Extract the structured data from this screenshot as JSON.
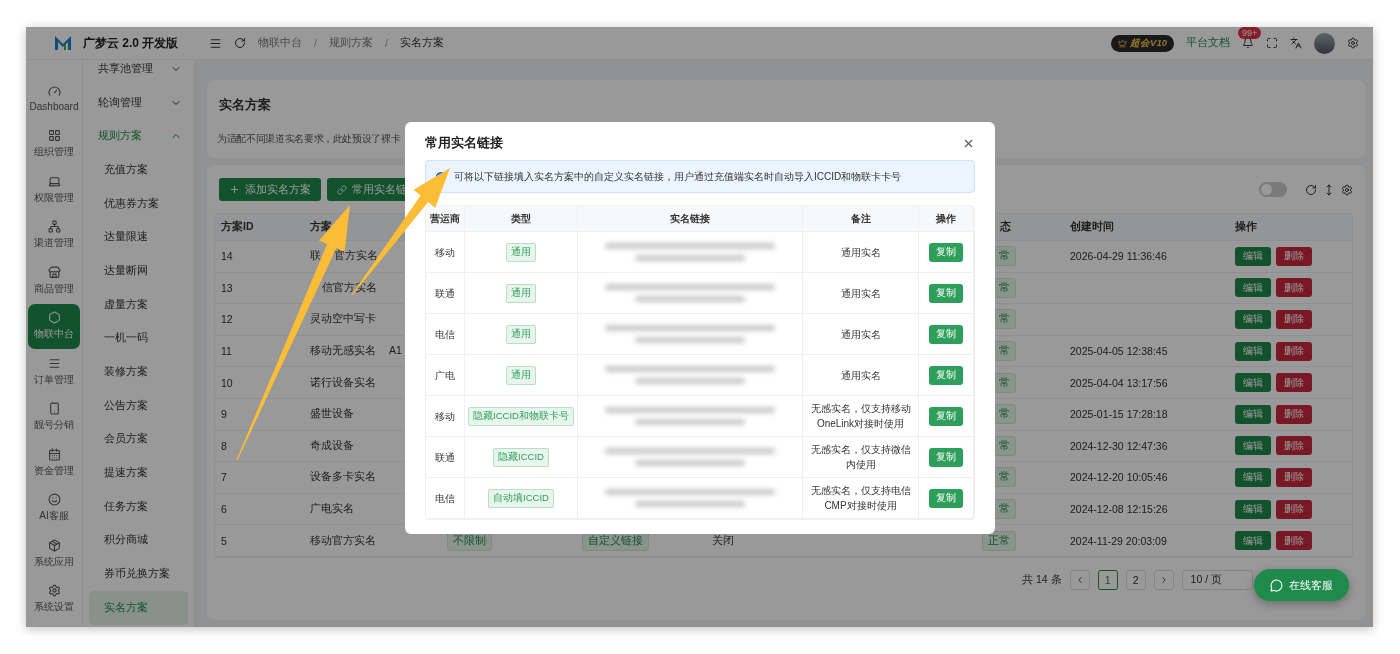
{
  "app": {
    "title": "广梦云 2.0 开发版"
  },
  "rail": [
    {
      "label": "Dashboard",
      "selected": false
    },
    {
      "label": "组织管理",
      "selected": false
    },
    {
      "label": "权限管理",
      "selected": false
    },
    {
      "label": "渠道管理",
      "selected": false
    },
    {
      "label": "商品管理",
      "selected": false
    },
    {
      "label": "物联中台",
      "selected": true
    },
    {
      "label": "订单管理",
      "selected": false
    },
    {
      "label": "靓号分销",
      "selected": false
    },
    {
      "label": "资金管理",
      "selected": false
    },
    {
      "label": "AI客服",
      "selected": false
    },
    {
      "label": "系统应用",
      "selected": false
    },
    {
      "label": "系统设置",
      "selected": false
    }
  ],
  "submenu": [
    {
      "label": "共享池管理",
      "expanded": false
    },
    {
      "label": "轮询管理",
      "expanded": false
    },
    {
      "label": "规则方案",
      "expanded": true,
      "children": [
        {
          "label": "充值方案",
          "selected": false
        },
        {
          "label": "优惠券方案",
          "selected": false
        },
        {
          "label": "达量限速",
          "selected": false
        },
        {
          "label": "达量断网",
          "selected": false
        },
        {
          "label": "虚量方案",
          "selected": false
        },
        {
          "label": "一机一码",
          "selected": false
        },
        {
          "label": "装修方案",
          "selected": false
        },
        {
          "label": "公告方案",
          "selected": false
        },
        {
          "label": "会员方案",
          "selected": false
        },
        {
          "label": "提速方案",
          "selected": false
        },
        {
          "label": "任务方案",
          "selected": false
        },
        {
          "label": "积分商城",
          "selected": false
        },
        {
          "label": "券币兑换方案",
          "selected": false
        },
        {
          "label": "实名方案",
          "selected": true
        }
      ]
    }
  ],
  "header": {
    "breadcrumb": [
      "物联中台",
      "规则方案",
      "实名方案"
    ],
    "separator": "/",
    "vip_badge": "超会V10",
    "docs_link": "平台文档",
    "notification_count": "99+"
  },
  "page": {
    "title": "实名方案",
    "description": "为适配不同渠道实名要求，此处预设了裸卡"
  },
  "toolbar": {
    "buttons": [
      "添加实名方案",
      "常用实名链"
    ],
    "toggle_on": false
  },
  "table": {
    "columns": {
      "id": "方案ID",
      "name": "方案",
      "status": "态",
      "created": "创建时间",
      "actions": "操作"
    },
    "rows": [
      {
        "id": "14",
        "name": "联 官方实名",
        "status": "常",
        "created": "2026-04-29 11:36:46",
        "actions": [
          "编辑",
          "删除"
        ]
      },
      {
        "id": "13",
        "name": "信官方实名",
        "name_offset": true,
        "status": "常",
        "actions": [
          "编辑",
          "删除"
        ]
      },
      {
        "id": "12",
        "name": "灵动空中写卡",
        "status": "常",
        "actions": [
          "编辑",
          "删除"
        ]
      },
      {
        "id": "11",
        "name": "移动无感实名 A1",
        "status": "常",
        "created": "2025-04-05 12:38:45",
        "actions": [
          "编辑",
          "删除"
        ]
      },
      {
        "id": "10",
        "name": "诺行设备实名",
        "status": "常",
        "created": "2025-04-04 13:17:56",
        "actions": [
          "编辑",
          "删除"
        ]
      },
      {
        "id": "9",
        "name": "盛世设备",
        "status": "常",
        "created": "2025-01-15 17:28:18",
        "actions": [
          "编辑",
          "删除"
        ]
      },
      {
        "id": "8",
        "name": "奇成设备",
        "status": "常",
        "created": "2024-12-30 12:47:36",
        "actions": [
          "编辑",
          "删除"
        ]
      },
      {
        "id": "7",
        "name": "设备多卡实名",
        "status": "常",
        "created": "2024-12-20 10:05:46",
        "actions": [
          "编辑",
          "删除"
        ]
      },
      {
        "id": "6",
        "name": "广电实名",
        "status": "常",
        "created": "2024-12-08 12:15:26",
        "actions": [
          "编辑",
          "删除"
        ]
      },
      {
        "id": "5",
        "name": "移动官方实名",
        "column_3": "不限制",
        "column_4": "自定义链接",
        "column_5": "关闭",
        "status": "正常",
        "created": "2024-11-29 20:03:09",
        "actions": [
          "编辑",
          "删除"
        ]
      }
    ]
  },
  "pagination": {
    "total": "共 14 条",
    "pages": [
      {
        "label": "1",
        "selected": true
      },
      {
        "label": "2",
        "selected": false
      }
    ],
    "page_size": "10 / 页"
  },
  "chat_button": "在线客服",
  "modal": {
    "title": "常用实名链接",
    "notice": "可将以下链接填入实名方案中的自定义实名链接，用户通过充值端实名时自动导入ICCID和物联卡卡号",
    "columns": [
      "营运商",
      "类型",
      "实名链接",
      "备注",
      "操作"
    ],
    "rows": [
      {
        "carrier": "移动",
        "type": "通用",
        "note": "通用实名",
        "action": "复制"
      },
      {
        "carrier": "联通",
        "type": "通用",
        "note": "通用实名",
        "action": "复制"
      },
      {
        "carrier": "电信",
        "type": "通用",
        "note": "通用实名",
        "action": "复制"
      },
      {
        "carrier": "广电",
        "type": "通用",
        "note": "通用实名",
        "action": "复制"
      },
      {
        "carrier": "移动",
        "type": "隐藏ICCID和物联卡号",
        "note": "无感实名，仅支持移动OneLink对接时使用",
        "action": "复制"
      },
      {
        "carrier": "联通",
        "type": "隐藏ICCID",
        "note": "无感实名，仅支持微信内使用",
        "action": "复制"
      },
      {
        "carrier": "电信",
        "type": "自动填ICCID",
        "note": "无感实名，仅支持电信CMP对接时使用",
        "action": "复制"
      }
    ]
  }
}
